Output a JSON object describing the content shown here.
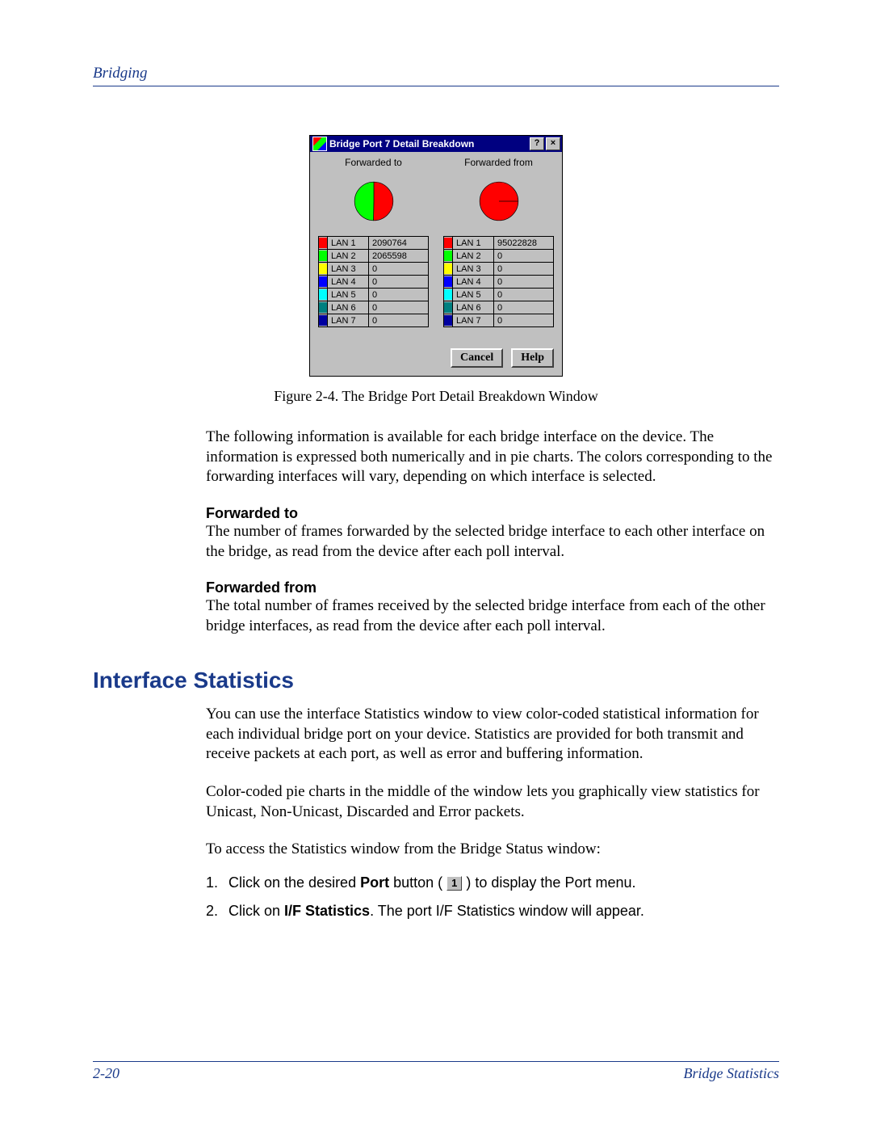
{
  "header": {
    "section": "Bridging"
  },
  "dialog": {
    "title": "Bridge Port 7 Detail Breakdown",
    "help_btn_char": "?",
    "close_btn_char": "×",
    "col_to_title": "Forwarded to",
    "col_from_title": "Forwarded from",
    "rows_to": [
      {
        "color": "#ff0000",
        "label": "LAN 1",
        "value": "2090764"
      },
      {
        "color": "#00ff00",
        "label": "LAN 2",
        "value": "2065598"
      },
      {
        "color": "#ffff00",
        "label": "LAN 3",
        "value": "0"
      },
      {
        "color": "#0000ff",
        "label": "LAN 4",
        "value": "0"
      },
      {
        "color": "#00ffff",
        "label": "LAN 5",
        "value": "0"
      },
      {
        "color": "#008080",
        "label": "LAN 6",
        "value": "0"
      },
      {
        "color": "#0000a0",
        "label": "LAN 7",
        "value": "0"
      }
    ],
    "rows_from": [
      {
        "color": "#ff0000",
        "label": "LAN 1",
        "value": "95022828"
      },
      {
        "color": "#00ff00",
        "label": "LAN 2",
        "value": "0"
      },
      {
        "color": "#ffff00",
        "label": "LAN 3",
        "value": "0"
      },
      {
        "color": "#0000ff",
        "label": "LAN 4",
        "value": "0"
      },
      {
        "color": "#00ffff",
        "label": "LAN 5",
        "value": "0"
      },
      {
        "color": "#008080",
        "label": "LAN 6",
        "value": "0"
      },
      {
        "color": "#0000a0",
        "label": "LAN 7",
        "value": "0"
      }
    ],
    "cancel_label": "Cancel",
    "help_label": "Help"
  },
  "chart_data": [
    {
      "type": "pie",
      "title": "Forwarded to",
      "series": [
        {
          "name": "LAN 1",
          "value": 2090764,
          "color": "#ff0000"
        },
        {
          "name": "LAN 2",
          "value": 2065598,
          "color": "#00ff00"
        },
        {
          "name": "LAN 3",
          "value": 0,
          "color": "#ffff00"
        },
        {
          "name": "LAN 4",
          "value": 0,
          "color": "#0000ff"
        },
        {
          "name": "LAN 5",
          "value": 0,
          "color": "#00ffff"
        },
        {
          "name": "LAN 6",
          "value": 0,
          "color": "#008080"
        },
        {
          "name": "LAN 7",
          "value": 0,
          "color": "#0000a0"
        }
      ]
    },
    {
      "type": "pie",
      "title": "Forwarded from",
      "series": [
        {
          "name": "LAN 1",
          "value": 95022828,
          "color": "#ff0000"
        },
        {
          "name": "LAN 2",
          "value": 0,
          "color": "#00ff00"
        },
        {
          "name": "LAN 3",
          "value": 0,
          "color": "#ffff00"
        },
        {
          "name": "LAN 4",
          "value": 0,
          "color": "#0000ff"
        },
        {
          "name": "LAN 5",
          "value": 0,
          "color": "#00ffff"
        },
        {
          "name": "LAN 6",
          "value": 0,
          "color": "#008080"
        },
        {
          "name": "LAN 7",
          "value": 0,
          "color": "#0000a0"
        }
      ]
    }
  ],
  "figure_caption": "Figure 2-4. The Bridge Port Detail Breakdown Window",
  "body": {
    "intro": "The following information is available for each bridge interface on the device. The information is expressed both numerically and in pie charts. The colors corresponding to the forwarding interfaces will vary, depending on which interface is selected.",
    "fwd_to_head": "Forwarded to",
    "fwd_to_text": "The number of frames forwarded by the selected bridge interface to each other interface on the bridge, as read from the device after each poll interval.",
    "fwd_from_head": "Forwarded from",
    "fwd_from_text": "The total number of frames received by the selected bridge interface from each of the other bridge interfaces, as read from the device after each poll interval."
  },
  "section": {
    "heading": "Interface Statistics",
    "p1": "You can use the interface Statistics window to view color-coded statistical information for each individual bridge port on your device. Statistics are provided for both transmit and receive packets at each port, as well as error and buffering information.",
    "p2": "Color-coded pie charts in the middle of the window lets you graphically view statistics for Unicast, Non-Unicast, Discarded and Error packets.",
    "p3": "To access the Statistics window from the Bridge Status window:",
    "steps": {
      "n1": "1.",
      "s1a": "Click on the desired ",
      "s1b": "Port",
      "s1c": " button ( ",
      "s1btn": "1",
      "s1d": " ) to display the Port menu.",
      "n2": "2.",
      "s2a": "Click on ",
      "s2b": "I/F Statistics",
      "s2c": ". The port I/F Statistics window will appear."
    }
  },
  "footer": {
    "page": "2-20",
    "section": "Bridge Statistics"
  }
}
